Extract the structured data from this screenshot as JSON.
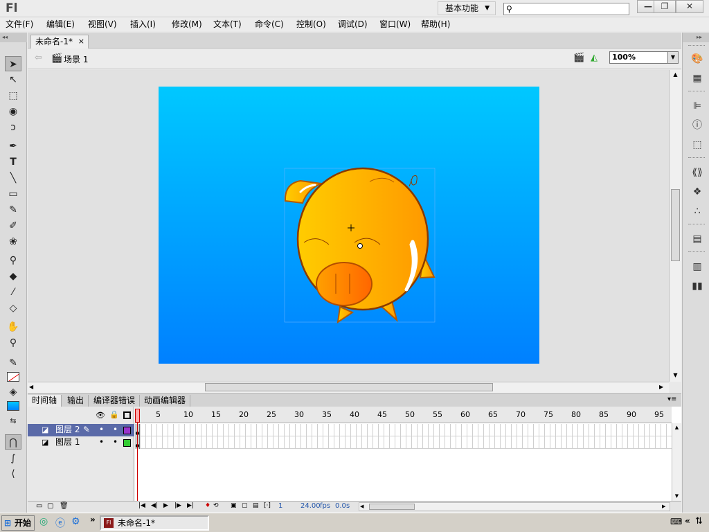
{
  "app": {
    "logo": "Fl",
    "workspace": "基本功能",
    "search_placeholder": ""
  },
  "window": {
    "minimize": "—",
    "restore": "❐",
    "close": "✕"
  },
  "menu": [
    "文件(F)",
    "编辑(E)",
    "视图(V)",
    "插入(I)",
    "修改(M)",
    "文本(T)",
    "命令(C)",
    "控制(O)",
    "调试(D)",
    "窗口(W)",
    "帮助(H)"
  ],
  "document": {
    "tab_title": "未命名-1*",
    "scene": "场景 1",
    "zoom": "100%"
  },
  "stage": {
    "gradient_top": "#00c8ff",
    "gradient_bottom": "#0080ff",
    "figure_color": "#ffaa00"
  },
  "timeline": {
    "tabs": [
      "时间轴",
      "输出",
      "编译器错误",
      "动画编辑器"
    ],
    "frame_numbers": [
      "1",
      "5",
      "10",
      "15",
      "20",
      "25",
      "30",
      "35",
      "40",
      "45",
      "50",
      "55",
      "60",
      "65",
      "70",
      "75",
      "80",
      "85",
      "90",
      "95"
    ],
    "layers": [
      {
        "name": "图层 2",
        "selected": true,
        "color": "#9933cc"
      },
      {
        "name": "图层 1",
        "selected": false,
        "color": "#33cc33"
      }
    ],
    "status": {
      "current_frame": "1",
      "fps": "24.00",
      "fps_unit": "fps",
      "time": "0.0",
      "time_unit": "s"
    }
  },
  "taskbar": {
    "start": "开始",
    "item": "未命名-1*",
    "arrows": "»"
  }
}
